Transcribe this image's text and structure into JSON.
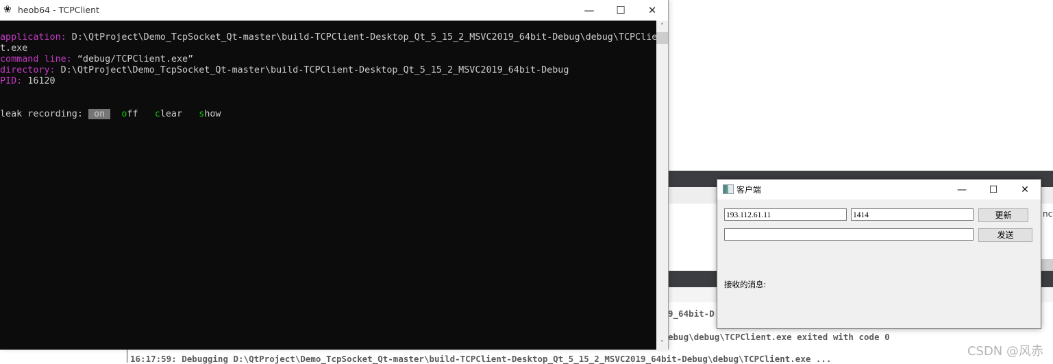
{
  "console_window": {
    "title": "heob64 - TCPClient",
    "icon": "heob-logo-icon",
    "controls": {
      "minimize": "—",
      "maximize": "☐",
      "close": "✕"
    },
    "lines": {
      "application_label": "application:",
      "application_value": " D:\\QtProject\\Demo_TcpSocket_Qt-master\\build-TCPClient-Desktop_Qt_5_15_2_MSVC2019_64bit-Debug\\debug\\TCPClien",
      "application_wrap": "t.exe",
      "command_line_label": "command line:",
      "command_line_value": " “debug/TCPClient.exe”",
      "directory_label": "directory:",
      "directory_value": " D:\\QtProject\\Demo_TcpSocket_Qt-master\\build-TCPClient-Desktop_Qt_5_15_2_MSVC2019_64bit-Debug",
      "pid_label": "PID:",
      "pid_value": " 16120"
    },
    "leak_recording": {
      "label": "leak recording: ",
      "options": [
        {
          "hotkey": "o",
          "rest": "n",
          "full": "on",
          "active": true
        },
        {
          "hotkey": "o",
          "rest": "ff",
          "full": "off",
          "active": false
        },
        {
          "hotkey": "c",
          "rest": "lear",
          "full": "clear",
          "active": false
        },
        {
          "hotkey": "s",
          "rest": "how",
          "full": "show",
          "active": false
        }
      ]
    },
    "scrollbar": {
      "up": "˄",
      "down": "˅"
    }
  },
  "client_window": {
    "title": "客户端",
    "controls": {
      "minimize": "—",
      "maximize": "☐",
      "close": "✕"
    },
    "ip_input": {
      "value": "193.112.61.11"
    },
    "port_input": {
      "value": "1414"
    },
    "update_button": "更新",
    "message_input": {
      "value": ""
    },
    "send_button": "发送",
    "received_label": "接收的消息:"
  },
  "ide_background": {
    "output_line_1": "9_64bit-D",
    "output_line_2": "ebug\\debug\\TCPClient.exe exited with code 0",
    "output_line_3": "16:17:59: Debugging D:\\QtProject\\Demo_TcpSocket_Qt-master\\build-TCPClient-Desktop_Qt_5_15_2_MSVC2019_64bit-Debug\\debug\\TCPClient.exe ...",
    "side_snippet": "nct"
  },
  "watermark": "CSDN @风赤"
}
